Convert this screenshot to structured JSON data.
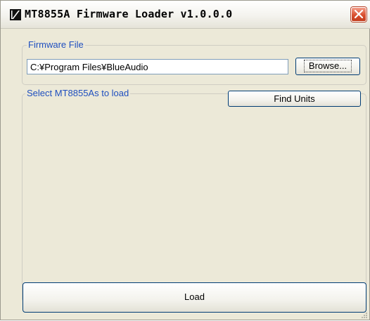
{
  "window": {
    "title": "MT8855A Firmware Loader v1.0.0.0",
    "icon": "app-logo-icon",
    "close_icon": "close-icon"
  },
  "firmware": {
    "group_label": "Firmware File",
    "path_value": "C:¥Program Files¥BlueAudio",
    "browse_label": "Browse..."
  },
  "units": {
    "group_label": "Select MT8855As to load",
    "find_label": "Find Units"
  },
  "actions": {
    "load_label": "Load"
  },
  "colors": {
    "group_label": "#1f4fbf",
    "background": "#ece9d8",
    "close_button": "#d9502f"
  }
}
